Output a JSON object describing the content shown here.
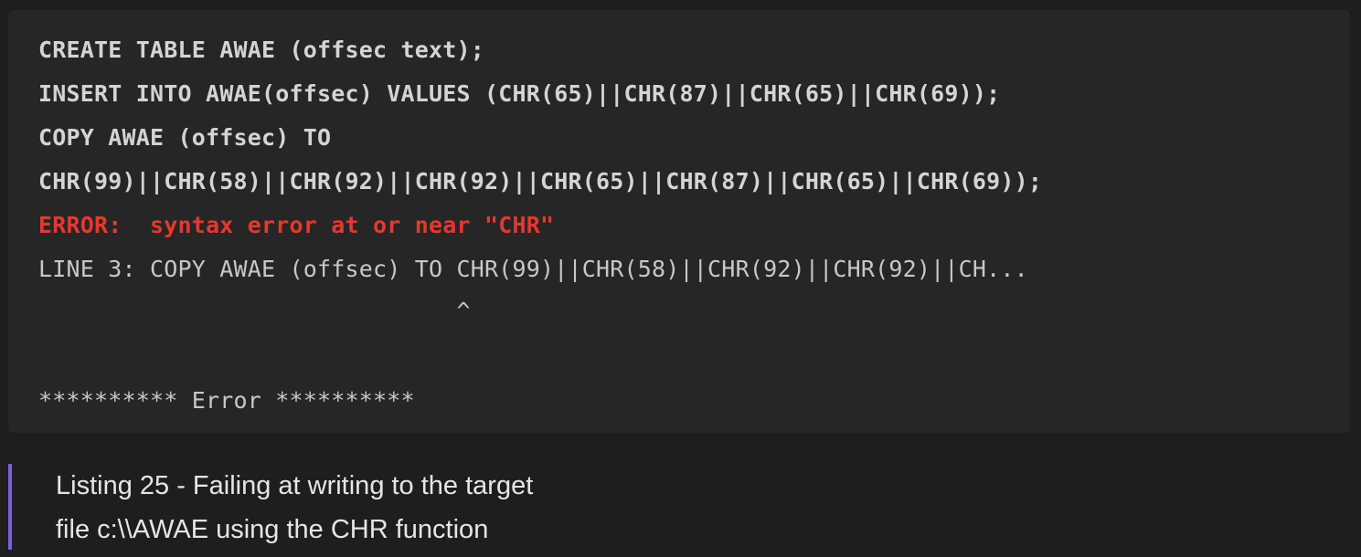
{
  "code": {
    "lines": [
      "CREATE TABLE AWAE (offsec text);",
      "INSERT INTO AWAE(offsec) VALUES (CHR(65)||CHR(87)||CHR(65)||CHR(69));",
      "COPY AWAE (offsec) TO",
      "CHR(99)||CHR(58)||CHR(92)||CHR(92)||CHR(65)||CHR(87)||CHR(65)||CHR(69));",
      "ERROR:  syntax error at or near \"CHR\"",
      "LINE 3: COPY AWAE (offsec) TO CHR(99)||CHR(58)||CHR(92)||CHR(92)||CH...",
      "                              ^",
      "",
      "********** Error **********"
    ]
  },
  "caption": {
    "lines": [
      "Listing 25 - Failing at writing to the target",
      "file c:\\\\AWAE using the CHR function"
    ]
  },
  "colors": {
    "error": "#e8372b",
    "quote_border": "#7b61d6",
    "background": "#1e1e1e",
    "code_background": "#262626"
  }
}
